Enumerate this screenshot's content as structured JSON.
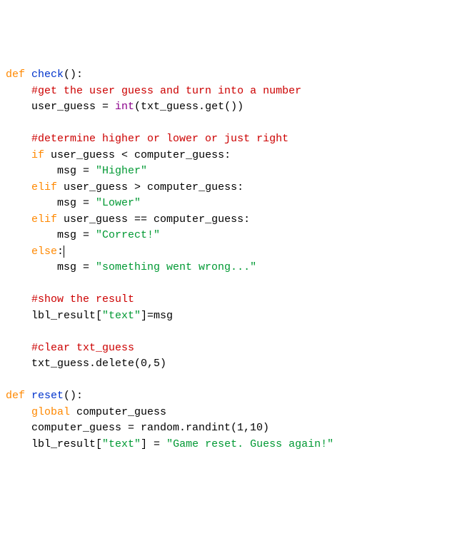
{
  "code": {
    "l1_def": "def",
    "l1_name": "check",
    "l1_rest": "():",
    "l2_cmt": "#get the user guess and turn into a number",
    "l3_var": "    user_guess = ",
    "l3_int": "int",
    "l3_rest": "(txt_guess.get())",
    "l5_cmt": "#determine higher or lower or just right",
    "l6_if": "if",
    "l6_cond": " user_guess < computer_guess:",
    "l7_assign": "        msg = ",
    "l7_str": "\"Higher\"",
    "l8_elif": "elif",
    "l8_cond": " user_guess > computer_guess:",
    "l9_assign": "        msg = ",
    "l9_str": "\"Lower\"",
    "l10_elif": "elif",
    "l10_cond": " user_guess == computer_guess:",
    "l11_assign": "        msg = ",
    "l11_str": "\"Correct!\"",
    "l12_else": "else",
    "l12_colon": ":",
    "l13_assign": "        msg = ",
    "l13_str": "\"something went wrong...\"",
    "l15_cmt": "#show the result",
    "l16_code_a": "    lbl_result[",
    "l16_str": "\"text\"",
    "l16_code_b": "]=msg",
    "l18_cmt": "#clear txt_guess",
    "l19_code": "    txt_guess.delete(0,5)",
    "l21_def": "def",
    "l21_name": "reset",
    "l21_rest": "():",
    "l22_global": "global",
    "l22_var": " computer_guess",
    "l23_code_a": "    computer_guess = random.randint(1,10)",
    "l24_code_a": "    lbl_result[",
    "l24_str": "\"text\"",
    "l24_code_b": "] = ",
    "l24_str2": "\"Game reset. Guess again!\""
  }
}
